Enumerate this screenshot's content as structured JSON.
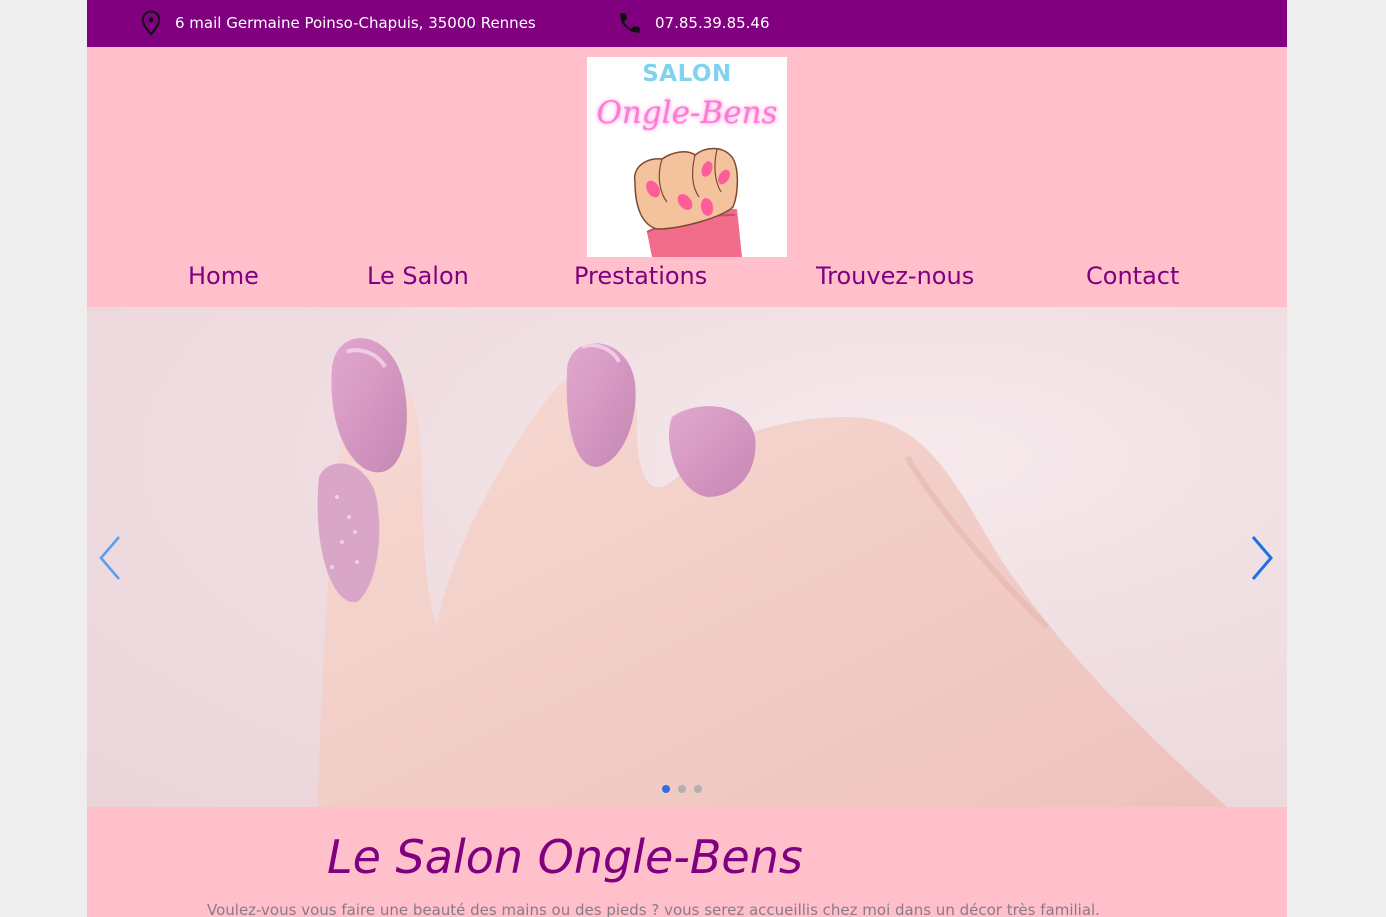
{
  "topbar": {
    "address": "6 mail Germaine Poinso-Chapuis, 35000 Rennes",
    "phone": "07.85.39.85.46",
    "address_icon": "map-pin-icon",
    "phone_icon": "phone-icon"
  },
  "logo": {
    "line1": "SALON",
    "line2": "Ongle-Bens"
  },
  "nav": {
    "items": [
      "Home",
      "Le Salon",
      "Prestations",
      "Trouvez-nous",
      "Contact"
    ]
  },
  "slider": {
    "current": 1,
    "total": 3,
    "prev_icon": "chevron-left-icon",
    "next_icon": "chevron-right-icon"
  },
  "intro": {
    "title": "Le Salon Ongle-Bens",
    "text": "Voulez-vous vous faire une beauté des mains ou des pieds ? vous serez accueillis chez moi dans un décor très familial."
  },
  "colors": {
    "topbar_bg": "#800080",
    "page_bg": "#ffc0cb",
    "accent": "#800080",
    "slider_dot_active": "#2f6fe0"
  }
}
